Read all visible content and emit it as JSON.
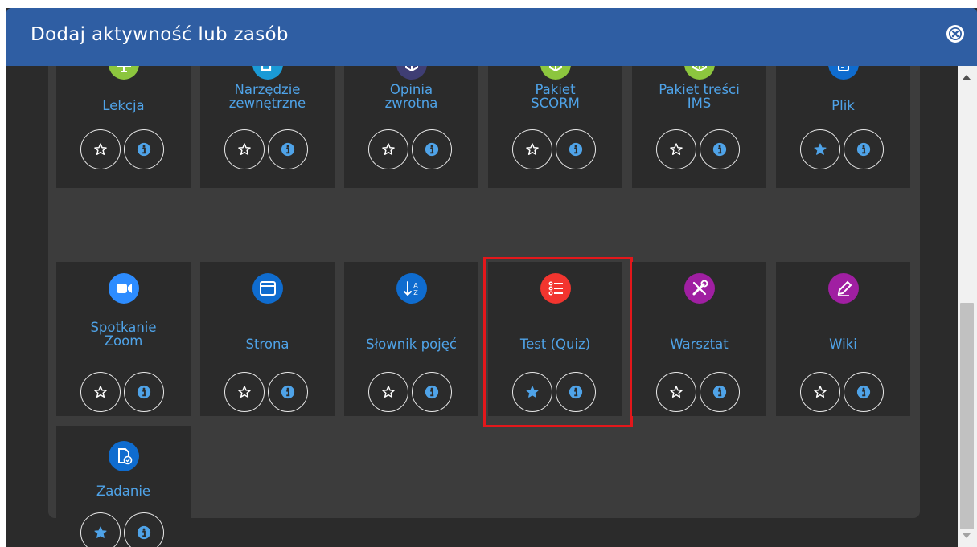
{
  "dialog": {
    "title": "Dodaj aktywność lub zasób",
    "close_icon": "close-circle-icon"
  },
  "rows": [
    [
      {
        "label_lines": [
          "Lekcja"
        ],
        "icon": "presentation-board-icon",
        "icon_color": "#8cc63e",
        "starred": false
      },
      {
        "label_lines": [
          "Narzędzie",
          "zewnętrzne"
        ],
        "icon": "puzzle-piece-icon",
        "icon_color": "#1a9ad6",
        "starred": false
      },
      {
        "label_lines": [
          "Opinia",
          "zwrotna"
        ],
        "icon": "feedback-box-icon",
        "icon_color": "#3f3e74",
        "starred": false
      },
      {
        "label_lines": [
          "Pakiet",
          "SCORM"
        ],
        "icon": "package-box-icon",
        "icon_color": "#8cc63e",
        "starred": false
      },
      {
        "label_lines": [
          "Pakiet treści",
          "IMS"
        ],
        "icon": "content-package-icon",
        "icon_color": "#8cc63e",
        "starred": false
      },
      {
        "label_lines": [
          "Plik"
        ],
        "icon": "document-file-icon",
        "icon_color": "#0f6ccf",
        "starred": true
      }
    ],
    [
      {
        "label_lines": [
          "Spotkanie",
          "Zoom"
        ],
        "icon": "video-camera-icon",
        "icon_color": "#2d8cff",
        "starred": false
      },
      {
        "label_lines": [
          "Strona"
        ],
        "icon": "browser-window-icon",
        "icon_color": "#0f6ccf",
        "starred": false
      },
      {
        "label_lines": [
          "Słownik pojęć"
        ],
        "icon": "glossary-sort-az-icon",
        "icon_color": "#0f6ccf",
        "starred": false
      },
      {
        "label_lines": [
          "Test (Quiz)"
        ],
        "icon": "checklist-icon",
        "icon_color": "#f2352f",
        "starred": true
      },
      {
        "label_lines": [
          "Warsztat"
        ],
        "icon": "wrench-screwdriver-icon",
        "icon_color": "#a01fa2",
        "starred": false
      },
      {
        "label_lines": [
          "Wiki"
        ],
        "icon": "pencil-icon",
        "icon_color": "#a01fa2",
        "starred": false
      }
    ],
    [
      {
        "label_lines": [
          "Zadanie"
        ],
        "icon": "assignment-document-icon",
        "icon_color": "#0f6ccf",
        "starred": true
      }
    ]
  ],
  "colors": {
    "header": "#2f5ea3",
    "label": "#4fa3e8",
    "highlight": "#e3171b"
  },
  "highlighted_item": "Test (Quiz)"
}
